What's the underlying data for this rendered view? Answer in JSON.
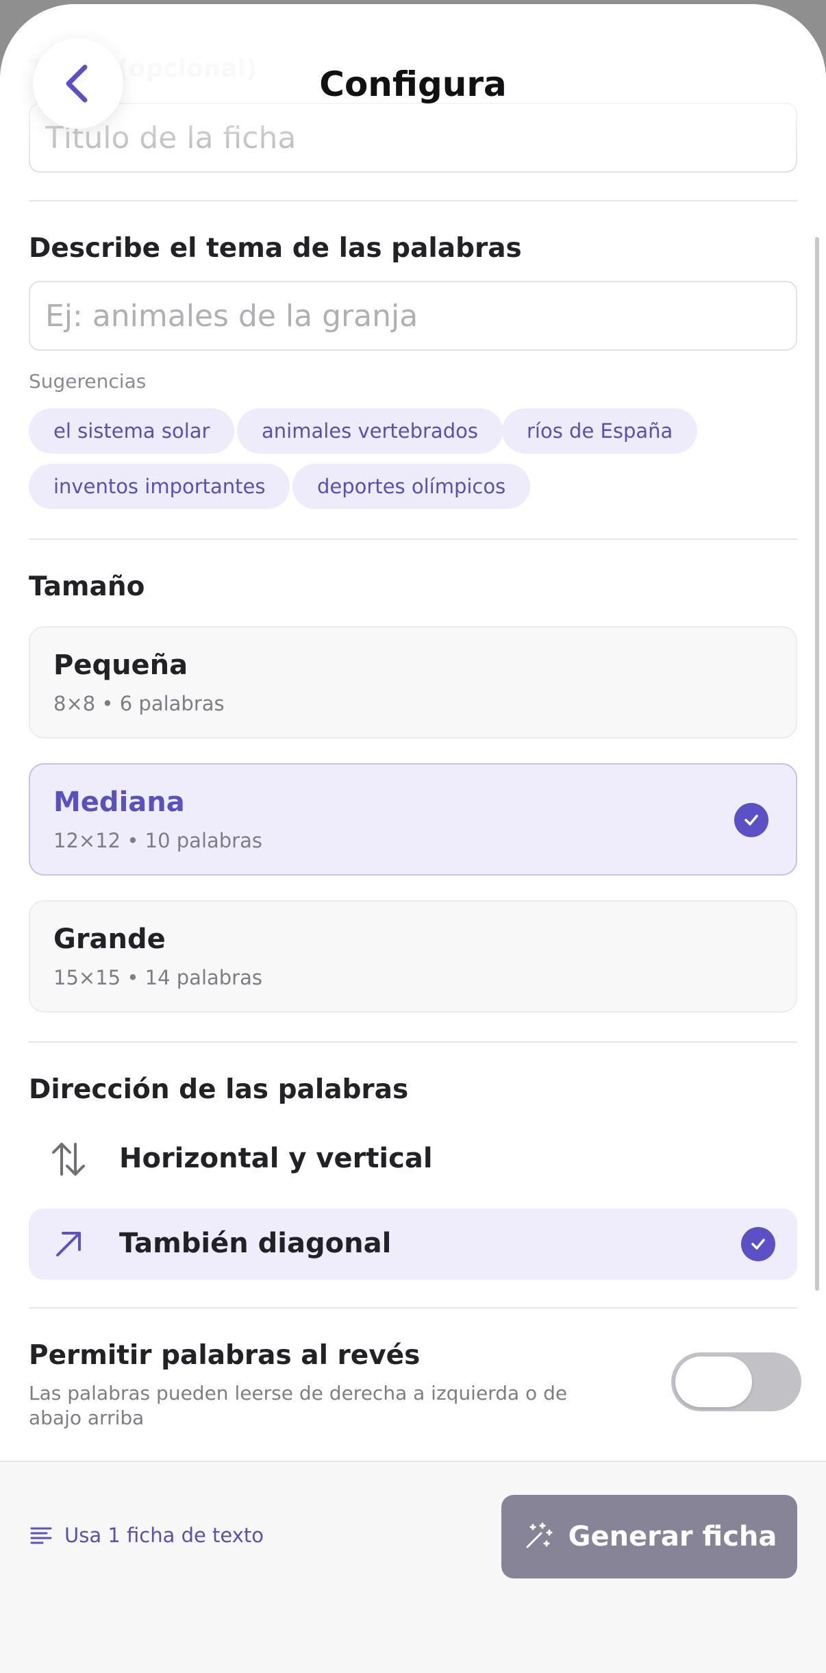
{
  "header": {
    "title": "Configura",
    "back_label": "Volver"
  },
  "title_field": {
    "label": "Título (opcional)",
    "placeholder": "Título de la ficha"
  },
  "theme": {
    "heading": "Describe el tema de las palabras",
    "placeholder": "Ej: animales de la granja",
    "suggestions_label": "Sugerencias",
    "suggestions": [
      "el sistema solar",
      "animales vertebrados",
      "ríos de España",
      "inventos importantes",
      "deportes olímpicos"
    ]
  },
  "size": {
    "heading": "Tamaño",
    "options": [
      {
        "name": "Pequeña",
        "detail": "8×8 • 6 palabras",
        "selected": false
      },
      {
        "name": "Mediana",
        "detail": "12×12 • 10 palabras",
        "selected": true
      },
      {
        "name": "Grande",
        "detail": "15×15 • 14 palabras",
        "selected": false
      }
    ]
  },
  "direction": {
    "heading": "Dirección de las palabras",
    "options": [
      {
        "label": "Horizontal y vertical",
        "icon": "arrows-up-down-icon",
        "selected": false
      },
      {
        "label": "También diagonal",
        "icon": "arrow-diagonal-icon",
        "selected": true
      }
    ]
  },
  "reverse": {
    "heading": "Permitir palabras al revés",
    "description": "Las palabras pueden leerse de derecha a izquierda o de abajo arriba",
    "enabled": false
  },
  "footer": {
    "credits_label": "Usa 1 ficha de texto",
    "generate_label": "Generar ficha"
  },
  "colors": {
    "accent": "#5b50c6",
    "chip_bg": "#eeecfb",
    "selected_bg": "#efedfb",
    "generate_btn_bg": "#878497"
  }
}
